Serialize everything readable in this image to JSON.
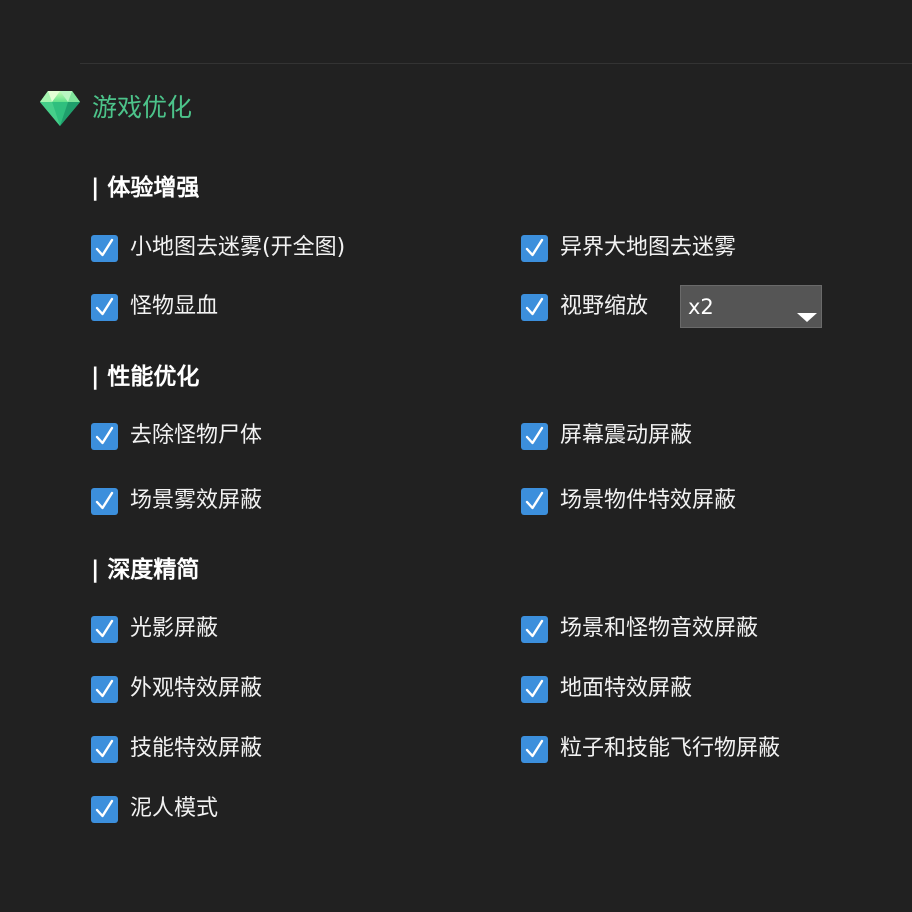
{
  "panel": {
    "title": "游戏优化",
    "icon": "diamond-icon",
    "accent_color": "#4cc38a"
  },
  "checkbox_color": "#3c8fdc",
  "sections": [
    {
      "title": "| 体验增强",
      "options": [
        {
          "label": "小地图去迷雾(开全图)",
          "checked": true
        },
        {
          "label": "异界大地图去迷雾",
          "checked": true
        },
        {
          "label": "怪物显血",
          "checked": true
        },
        {
          "label": "视野缩放",
          "checked": true
        }
      ],
      "zoom_select": {
        "value": "x2"
      }
    },
    {
      "title": "| 性能优化",
      "options": [
        {
          "label": "去除怪物尸体",
          "checked": true
        },
        {
          "label": "屏幕震动屏蔽",
          "checked": true
        },
        {
          "label": "场景雾效屏蔽",
          "checked": true
        },
        {
          "label": "场景物件特效屏蔽",
          "checked": true
        }
      ]
    },
    {
      "title": "| 深度精简",
      "options": [
        {
          "label": "光影屏蔽",
          "checked": true
        },
        {
          "label": "场景和怪物音效屏蔽",
          "checked": true
        },
        {
          "label": "外观特效屏蔽",
          "checked": true
        },
        {
          "label": "地面特效屏蔽",
          "checked": true
        },
        {
          "label": "技能特效屏蔽",
          "checked": true
        },
        {
          "label": "粒子和技能飞行物屏蔽",
          "checked": true
        },
        {
          "label": "泥人模式",
          "checked": true
        }
      ]
    }
  ]
}
